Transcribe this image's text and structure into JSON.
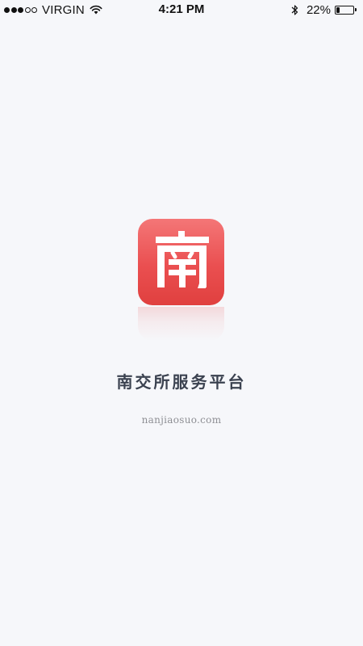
{
  "status_bar": {
    "carrier": "VIRGIN",
    "time": "4:21 PM",
    "battery_percent": "22%",
    "signal_bars_filled": 3,
    "signal_bars_total": 5,
    "battery_level": 0.22,
    "icons": [
      "signal-dots",
      "wifi-icon",
      "bluetooth-icon",
      "battery-icon"
    ]
  },
  "splash": {
    "logo_glyph": "南",
    "logo_gradient": [
      "#f47677",
      "#e0403f"
    ],
    "title": "南交所服务平台",
    "url": "nanjiaosuo.com"
  },
  "colors": {
    "background": "#f6f7fa",
    "title_text": "#3b4250",
    "url_text": "#8e8f94",
    "brand_red": "#e84b4c"
  }
}
